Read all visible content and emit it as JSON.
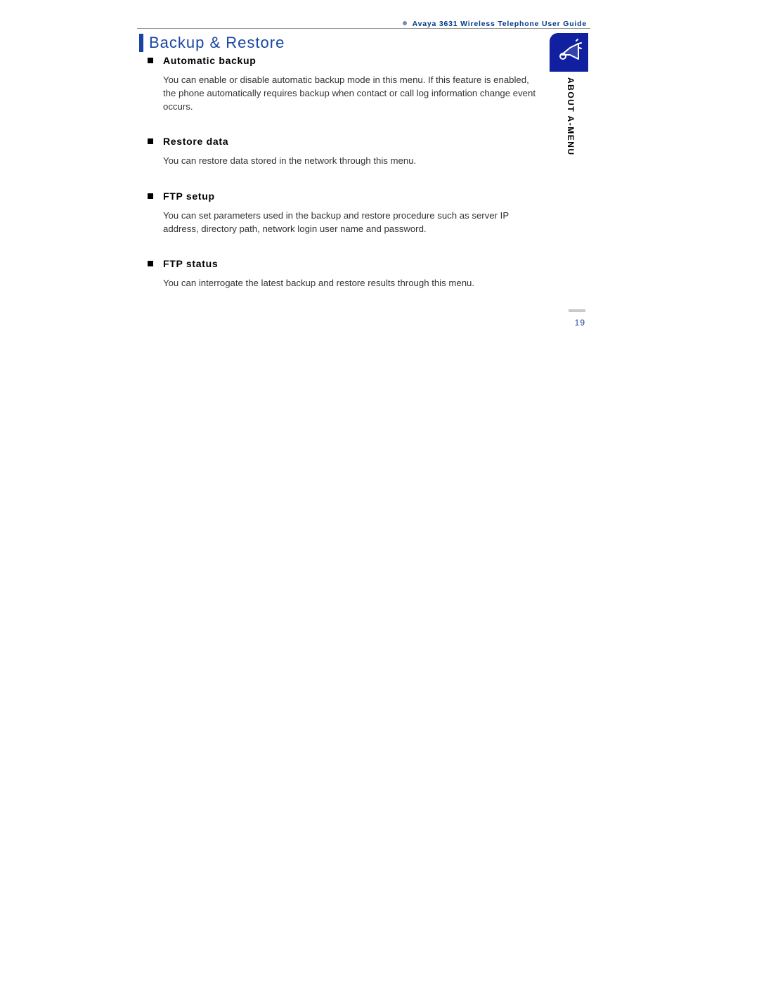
{
  "header": {
    "guide_title": "Avaya 3631 Wireless Telephone User Guide"
  },
  "section": {
    "title": "Backup & Restore"
  },
  "sidebar": {
    "label": "ABOUT A-MENU"
  },
  "items": [
    {
      "title": "Automatic backup",
      "desc": "You can enable or disable automatic backup mode in this menu. If this feature is enabled, the phone automatically requires backup when contact or call log information change event occurs."
    },
    {
      "title": "Restore data",
      "desc": "You can restore data stored in the network through this menu."
    },
    {
      "title": "FTP setup",
      "desc": "You can set parameters used in the backup and restore procedure such as server IP address, directory path, network login user name and password."
    },
    {
      "title": "FTP status",
      "desc": "You can interrogate the latest backup and restore results through this menu."
    }
  ],
  "page_number": "19"
}
